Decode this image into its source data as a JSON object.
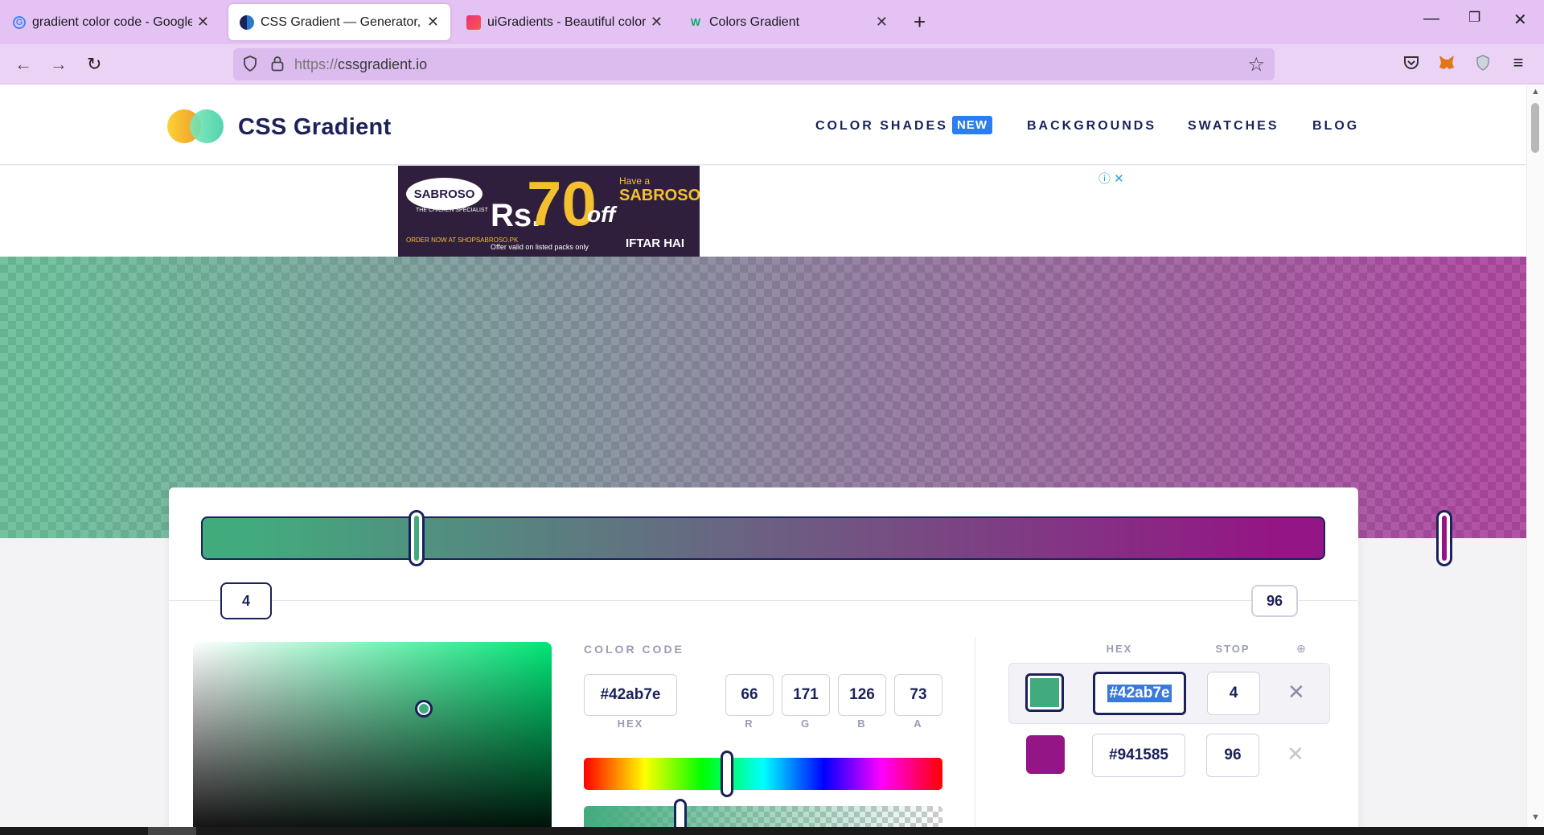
{
  "browser": {
    "tabs": [
      {
        "title": "gradient color code - Google Se",
        "favicon": "google-icon",
        "active": false
      },
      {
        "title": "CSS Gradient — Generator, Mak",
        "favicon": "cssgradient-icon",
        "active": true
      },
      {
        "title": "uiGradients - Beautiful colored",
        "favicon": "uigradients-icon",
        "active": false
      },
      {
        "title": "Colors Gradient",
        "favicon": "w3schools-icon",
        "active": false
      }
    ],
    "url_scheme": "https://",
    "url_host": "cssgradient.io"
  },
  "site": {
    "brand": "CSS Gradient",
    "nav": {
      "color_shades": "COLOR SHADES",
      "new_badge": "NEW",
      "backgrounds": "BACKGROUNDS",
      "swatches": "SWATCHES",
      "blog": "BLOG"
    }
  },
  "ad": {
    "logo": "SABROSO",
    "tagline": "THE CHICKEN SPECIALIST",
    "price_prefix": "Rs.",
    "price": "70",
    "off": "off",
    "have_a": "Have a",
    "headline": "SABROSO RA",
    "iftar": "IFTAR  HAI",
    "valid": "Offer valid on listed packs only",
    "order": "ORDER NOW AT SHOPSABROSO.PK"
  },
  "gradient": {
    "stops": [
      {
        "hex": "#42ab7e",
        "stop": "4",
        "color": "#42ab7e",
        "selected": true
      },
      {
        "hex": "#941585",
        "stop": "96",
        "color": "#941585",
        "selected": false
      }
    ]
  },
  "editor": {
    "color_code_label": "COLOR CODE",
    "hex_value": "#42ab7e",
    "hex_label": "HEX",
    "r": "66",
    "g": "171",
    "b": "126",
    "a": "73",
    "r_label": "R",
    "g_label": "G",
    "b_label": "B",
    "a_label": "A",
    "hue_level": 0.4,
    "alpha_level": 0.27,
    "list_hex_header": "HEX",
    "list_stop_header": "STOP"
  },
  "colors": {
    "accent": "#1b2159",
    "badge": "#2b7df0",
    "tab_bar": "#e4c2f3"
  }
}
